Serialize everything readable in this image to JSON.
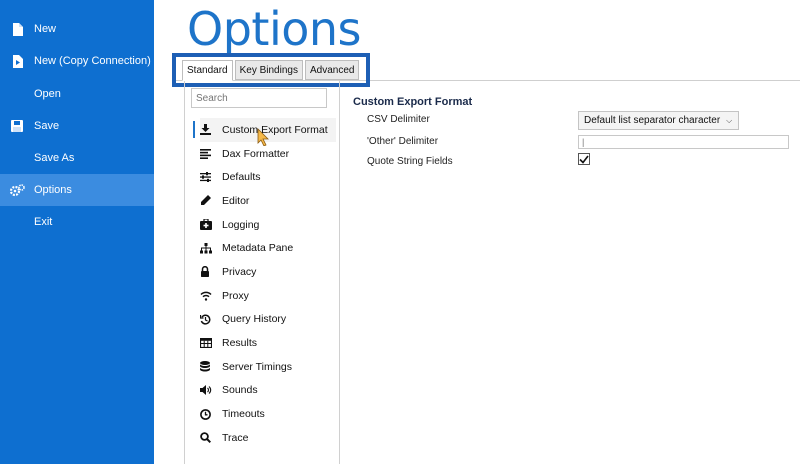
{
  "sidebar": {
    "items": [
      {
        "label": "New",
        "icon": "new-file-icon"
      },
      {
        "label": "New (Copy Connection)",
        "icon": "copy-connection-icon"
      },
      {
        "label": "Open",
        "icon": ""
      },
      {
        "label": "Save",
        "icon": "save-icon"
      },
      {
        "label": "Save As",
        "icon": ""
      },
      {
        "label": "Options",
        "icon": "gears-icon",
        "active": true
      },
      {
        "label": "Exit",
        "icon": ""
      }
    ]
  },
  "page": {
    "title": "Options"
  },
  "tabs": [
    {
      "label": "Standard",
      "selected": true
    },
    {
      "label": "Key Bindings"
    },
    {
      "label": "Advanced"
    }
  ],
  "search": {
    "placeholder": "Search"
  },
  "categories": [
    {
      "label": "Custom Export Format",
      "icon": "download-icon"
    },
    {
      "label": "Dax Formatter",
      "icon": "align-icon"
    },
    {
      "label": "Defaults",
      "icon": "sliders-icon"
    },
    {
      "label": "Editor",
      "icon": "pencil-icon"
    },
    {
      "label": "Logging",
      "icon": "medkit-icon"
    },
    {
      "label": "Metadata Pane",
      "icon": "sitemap-icon"
    },
    {
      "label": "Privacy",
      "icon": "lock-icon"
    },
    {
      "label": "Proxy",
      "icon": "wifi-icon"
    },
    {
      "label": "Query History",
      "icon": "history-icon"
    },
    {
      "label": "Results",
      "icon": "table-icon"
    },
    {
      "label": "Server Timings",
      "icon": "database-icon"
    },
    {
      "label": "Sounds",
      "icon": "volume-icon"
    },
    {
      "label": "Timeouts",
      "icon": "clock-icon"
    },
    {
      "label": "Trace",
      "icon": "search-icon"
    }
  ],
  "section": {
    "title": "Custom Export Format",
    "csv_label": "CSV Delimiter",
    "csv_value": "Default list separator character",
    "other_label": "'Other' Delimiter",
    "other_value": "|",
    "quote_label": "Quote String Fields",
    "quote_checked": true
  },
  "colors": {
    "sidebar": "#0e6fd0",
    "sidebar_active": "#3b8ce0",
    "title": "#1e74c9",
    "highlight_box": "#1d5fb5"
  }
}
